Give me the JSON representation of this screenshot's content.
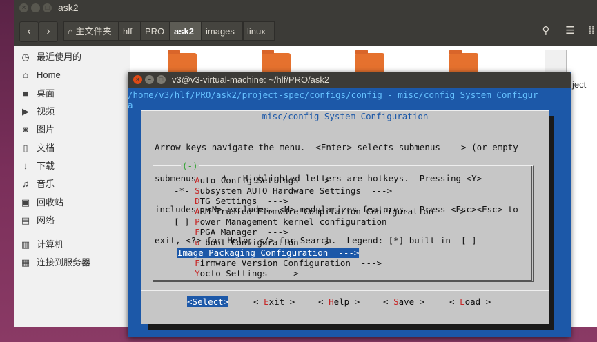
{
  "file_manager": {
    "title": "ask2",
    "toolbar": {
      "back_icon": "chevron-left-icon",
      "forward_icon": "chevron-right-icon",
      "breadcrumbs": [
        "主文件夹",
        "hlf",
        "PRO",
        "ask2",
        "images",
        "linux"
      ],
      "active_crumb": "ask2",
      "home_icon": "home-icon",
      "search_icon": "search-icon",
      "list_icon": "list-view-icon",
      "grid_icon": "grid-view-icon"
    },
    "sidebar": {
      "items": [
        {
          "label": "最近使用的",
          "icon": "clock-icon"
        },
        {
          "label": "Home",
          "icon": "home-icon"
        },
        {
          "label": "桌面",
          "icon": "folder-icon"
        },
        {
          "label": "视频",
          "icon": "video-icon"
        },
        {
          "label": "图片",
          "icon": "camera-icon"
        },
        {
          "label": "文档",
          "icon": "document-icon"
        },
        {
          "label": "下载",
          "icon": "download-icon"
        },
        {
          "label": "音乐",
          "icon": "music-icon"
        },
        {
          "label": "回收站",
          "icon": "trash-icon"
        },
        {
          "label": "网络",
          "icon": "network-icon"
        },
        {
          "label": "计算机",
          "icon": "computer-icon"
        },
        {
          "label": "连接到服务器",
          "icon": "server-icon"
        }
      ]
    },
    "visible_file_fragment": "ject"
  },
  "terminal": {
    "title": "v3@v3-virtual-machine: ~/hlf/PRO/ask2",
    "path_line1": "/home/v3/hlf/PRO/ask2/project-spec/configs/config - misc/config System Configur",
    "path_line2": "a",
    "dialog": {
      "title": "misc/config System Configuration",
      "help_lines": [
        "Arrow keys navigate the menu.  <Enter> selects submenus ---> (or empty",
        "submenus ----).  Highlighted letters are hotkeys.  Pressing <Y>",
        "includes, <N> excludes, <M> modularizes features.  Press <Esc><Esc> to",
        "exit, <?> for Help, </> for Search.  Legend: [*] built-in  [ ]"
      ],
      "scroll_indicator": "(-)",
      "menu_items": [
        {
          "prefix": "    ",
          "hotkey": "A",
          "rest": "uto Config Settings  --->",
          "selected": false
        },
        {
          "prefix": "-*- ",
          "hotkey": "S",
          "rest": "ubsystem AUTO Hardware Settings  --->",
          "selected": false
        },
        {
          "prefix": "    ",
          "hotkey": "D",
          "rest": "TG Settings  --->",
          "selected": false
        },
        {
          "prefix": "    ",
          "hotkey": "A",
          "rest": "RM Trusted Firmware Compilation Configuration  --->",
          "selected": false
        },
        {
          "prefix": "[ ] ",
          "hotkey": "P",
          "rest": "ower Management kernel configuration",
          "selected": false
        },
        {
          "prefix": "    ",
          "hotkey": "F",
          "rest": "PGA Manager  --->",
          "selected": false
        },
        {
          "prefix": "    ",
          "hotkey": "u",
          "rest": "-boot Configuration  --->",
          "selected": false
        },
        {
          "prefix": "    ",
          "hotkey": "I",
          "rest": "mage Packaging Configuration  --->",
          "selected": true
        },
        {
          "prefix": "    ",
          "hotkey": "F",
          "rest": "irmware Version Configuration  --->",
          "selected": false
        },
        {
          "prefix": "    ",
          "hotkey": "Y",
          "rest": "octo Settings  --->",
          "selected": false
        }
      ],
      "buttons": [
        {
          "pre": "<",
          "hotkey": "S",
          "rest": "elect>",
          "selected": true
        },
        {
          "pre": "< ",
          "hotkey": "E",
          "rest": "xit >",
          "selected": false
        },
        {
          "pre": "< ",
          "hotkey": "H",
          "rest": "elp >",
          "selected": false
        },
        {
          "pre": "< ",
          "hotkey": "S",
          "rest": "ave >",
          "selected": false
        },
        {
          "pre": "< ",
          "hotkey": "L",
          "rest": "oad >",
          "selected": false
        }
      ]
    }
  },
  "colors": {
    "menuconfig_blue": "#1c58a8",
    "dialog_gray": "#c6c6c6",
    "hotkey_red": "#c62828",
    "folder_orange": "#e5712e"
  }
}
